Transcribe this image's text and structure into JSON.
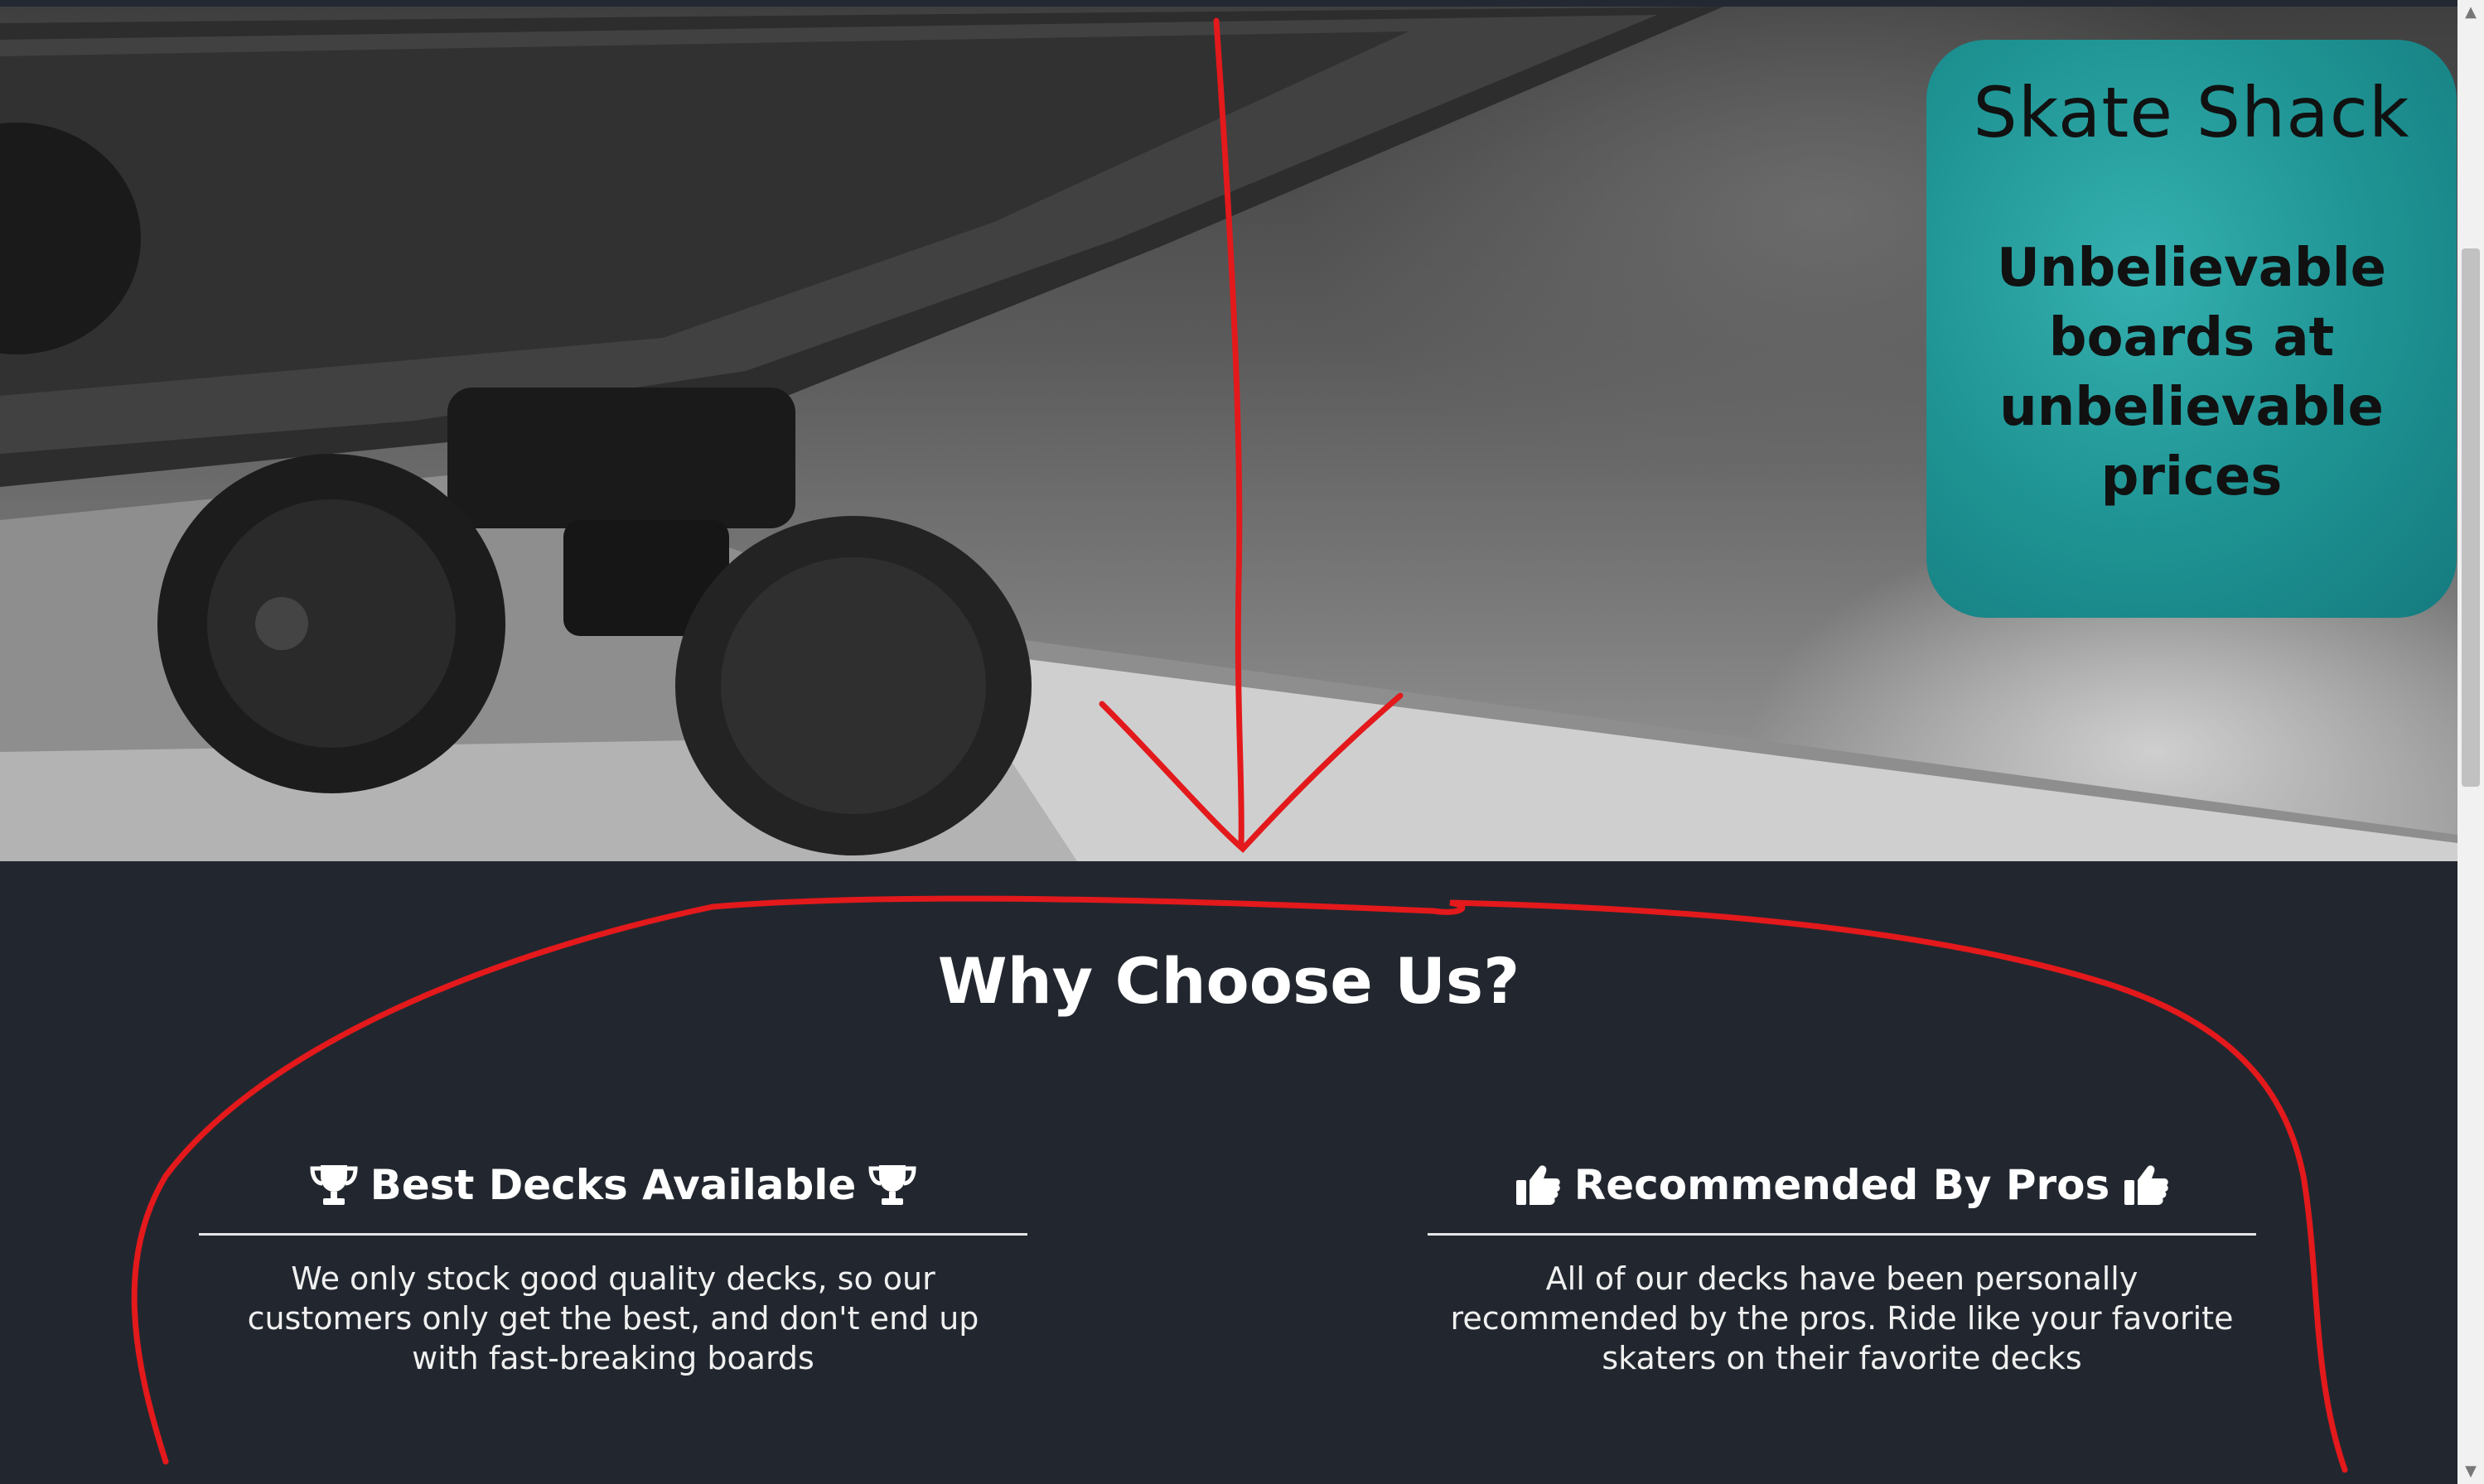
{
  "hero": {
    "brand_title": "Skate Shack",
    "tagline": "Unbelievable boards at unbelievable prices",
    "image_icon": "skateboard-photo"
  },
  "why": {
    "title": "Why Choose Us?",
    "features": [
      {
        "icon": "trophy-icon",
        "title": "Best Decks Available",
        "text": "We only stock good quality decks, so our customers only get the best, and don't end up with fast-breaking boards"
      },
      {
        "icon": "thumbs-up-icon",
        "title": "Recommended By Pros",
        "text": "All of our decks have been personally recommended by the pros. Ride like your favorite skaters on their favorite decks"
      }
    ]
  },
  "colors": {
    "background": "#22272f",
    "brand_card": "#1e9292",
    "annotation": "#e3191c"
  }
}
